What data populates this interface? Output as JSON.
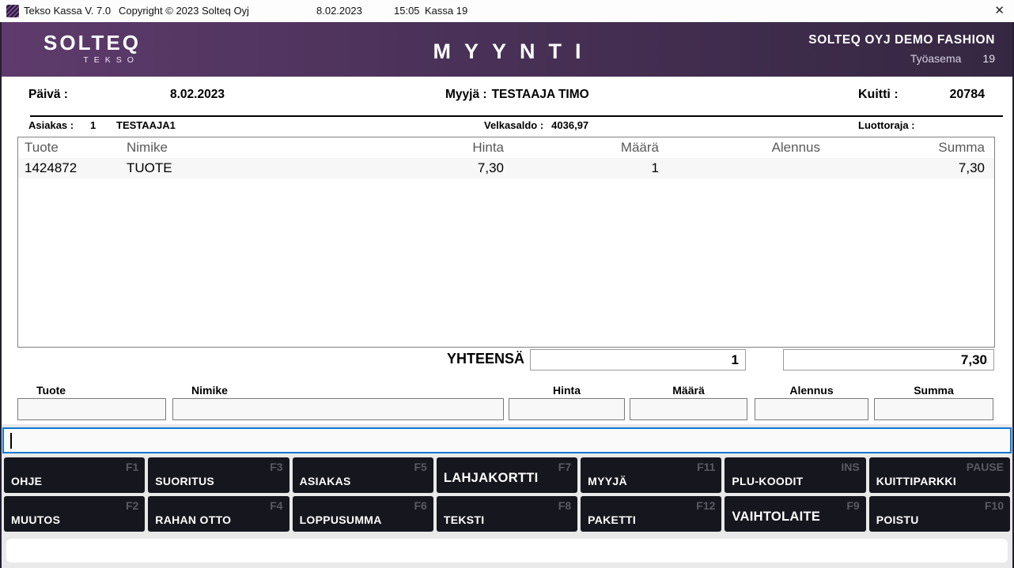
{
  "titlebar": {
    "app_title": "Tekso Kassa V. 7.0",
    "copyright": "Copyright © 2023 Solteq Oyj",
    "date": "8.02.2023",
    "time": "15:05",
    "register": "Kassa 19",
    "close_glyph": "✕"
  },
  "header": {
    "logo_main": "SOLTEQ",
    "logo_sub": "TEKSO",
    "title": "MYYNTI",
    "store_name": "SOLTEQ OYJ DEMO FASHION",
    "workstation_label": "Työasema",
    "workstation_number": "19"
  },
  "sale_info": {
    "date_label": "Päivä :",
    "date_value": "8.02.2023",
    "seller_label": "Myyjä :",
    "seller_value": "TESTAAJA TIMO",
    "receipt_label": "Kuitti :",
    "receipt_number": "20784"
  },
  "customer": {
    "label": "Asiakas :",
    "number": "1",
    "name": "TESTAAJA1",
    "debt_label": "Velkasaldo :",
    "debt_value": "4036,97",
    "credit_label": "Luottoraja :",
    "credit_value": ""
  },
  "items_table": {
    "headers": {
      "tuote": "Tuote",
      "nimike": "Nimike",
      "hinta": "Hinta",
      "maara": "Määrä",
      "alennus": "Alennus",
      "summa": "Summa"
    },
    "rows": [
      {
        "tuote": "1424872",
        "nimike": "TUOTE",
        "hinta": "7,30",
        "maara": "1",
        "alennus": "",
        "summa": "7,30"
      }
    ]
  },
  "totals": {
    "label": "YHTEENSÄ",
    "total_quantity": "1",
    "total_sum": "7,30"
  },
  "entry": {
    "labels": {
      "tuote": "Tuote",
      "nimike": "Nimike",
      "hinta": "Hinta",
      "maara": "Määrä",
      "alennus": "Alennus",
      "summa": "Summa"
    },
    "values": {
      "tuote": "",
      "nimike": "",
      "hinta": "",
      "maara": "",
      "alennus": "",
      "summa": ""
    }
  },
  "command_input": {
    "value": ""
  },
  "function_keys": {
    "row1": [
      {
        "label": "OHJE",
        "key": "F1"
      },
      {
        "label": "SUORITUS",
        "key": "F3"
      },
      {
        "label": "ASIAKAS",
        "key": "F5"
      },
      {
        "label": "LAHJAKORTTI",
        "key": "F7"
      },
      {
        "label": "MYYJÄ",
        "key": "F11"
      },
      {
        "label": "PLU-KOODIT",
        "key": "INS"
      },
      {
        "label": "KUITTIPARKKI",
        "key": "PAUSE"
      }
    ],
    "row2": [
      {
        "label": "MUUTOS",
        "key": "F2"
      },
      {
        "label": "RAHAN OTTO",
        "key": "F4"
      },
      {
        "label": "LOPPUSUMMA",
        "key": "F6"
      },
      {
        "label": "TEKSTI",
        "key": "F8"
      },
      {
        "label": "PAKETTI",
        "key": "F12"
      },
      {
        "label": "VAIHTOLAITE",
        "key": "F9"
      },
      {
        "label": "POISTU",
        "key": "F10"
      }
    ]
  },
  "colors": {
    "header_gradient_start": "#5e3b6c",
    "header_gradient_end": "#352741",
    "function_button_bg": "#16161e",
    "function_key_text": "#5a5a63",
    "focus_border_blue": "#0e78d2",
    "table_header_text": "#595959",
    "table_row_bg": "#f7f7f7"
  }
}
